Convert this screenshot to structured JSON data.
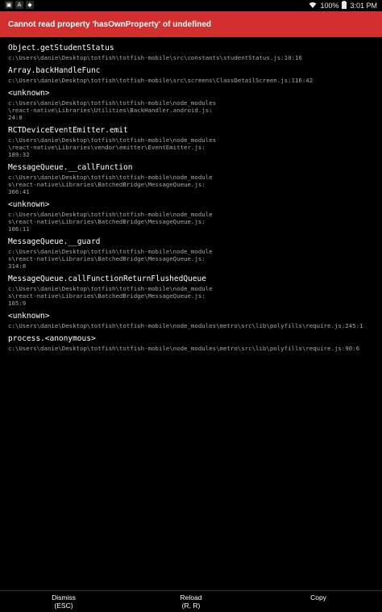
{
  "status_bar": {
    "battery": "100%",
    "time": "3:01 PM",
    "left_icons": [
      "notification-icon",
      "alert-icon",
      "app-icon"
    ]
  },
  "error": {
    "title": "Cannot read property 'hasOwnProperty' of undefined"
  },
  "stack": [
    {
      "method": "Object.getStudentStatus",
      "file": "c:\\Users\\danie\\Desktop\\totfish\\totfish-mobile\\src\\constants\\studentStatus.js:10:16"
    },
    {
      "method": "Array.backHandleFunc",
      "file": "c:\\Users\\danie\\Desktop\\totfish\\totfish-mobile\\src\\screens\\ClassDetailScreen.js:116:42"
    },
    {
      "method": "<unknown>",
      "file": "c:\\Users\\danie\\Desktop\\totfish\\totfish-mobile\\node_modules\n\\react-native\\Libraries\\Utilities\\BackHandler.android.js:\n24:8"
    },
    {
      "method": "RCTDeviceEventEmitter.emit",
      "file": "c:\\Users\\danie\\Desktop\\totfish\\totfish-mobile\\node_modules\n\\react-native\\Libraries\\vendor\\emitter\\EventEmitter.js:\n189:32"
    },
    {
      "method": "MessageQueue.__callFunction",
      "file": "c:\\Users\\danie\\Desktop\\totfish\\totfish-mobile\\node_module\ns\\react-native\\Libraries\\BatchedBridge\\MessageQueue.js:\n366:41"
    },
    {
      "method": "<unknown>",
      "file": "c:\\Users\\danie\\Desktop\\totfish\\totfish-mobile\\node_module\ns\\react-native\\Libraries\\BatchedBridge\\MessageQueue.js:\n106:11"
    },
    {
      "method": "MessageQueue.__guard",
      "file": "c:\\Users\\danie\\Desktop\\totfish\\totfish-mobile\\node_module\ns\\react-native\\Libraries\\BatchedBridge\\MessageQueue.js:\n314:8"
    },
    {
      "method": "MessageQueue.callFunctionReturnFlushedQueue",
      "file": "c:\\Users\\danie\\Desktop\\totfish\\totfish-mobile\\node_module\ns\\react-native\\Libraries\\BatchedBridge\\MessageQueue.js:\n105:9"
    },
    {
      "method": "<unknown>",
      "file": "c:\\Users\\danie\\Desktop\\totfish\\totfish-mobile\\node_modules\\metro\\src\\lib\\polyfills\\require.js:245:1"
    },
    {
      "method": "process.<anonymous>",
      "file": "c:\\Users\\danie\\Desktop\\totfish\\totfish-mobile\\node_modules\\metro\\src\\lib\\polyfills\\require.js:90:6"
    }
  ],
  "actions": {
    "dismiss": {
      "label": "Dismiss",
      "shortcut": "(ESC)"
    },
    "reload": {
      "label": "Reload",
      "shortcut": "(R, R)"
    },
    "copy": {
      "label": "Copy"
    }
  },
  "colors": {
    "header_red": "#d32f2f",
    "background": "#000000",
    "file_text": "#a8a8a8"
  }
}
